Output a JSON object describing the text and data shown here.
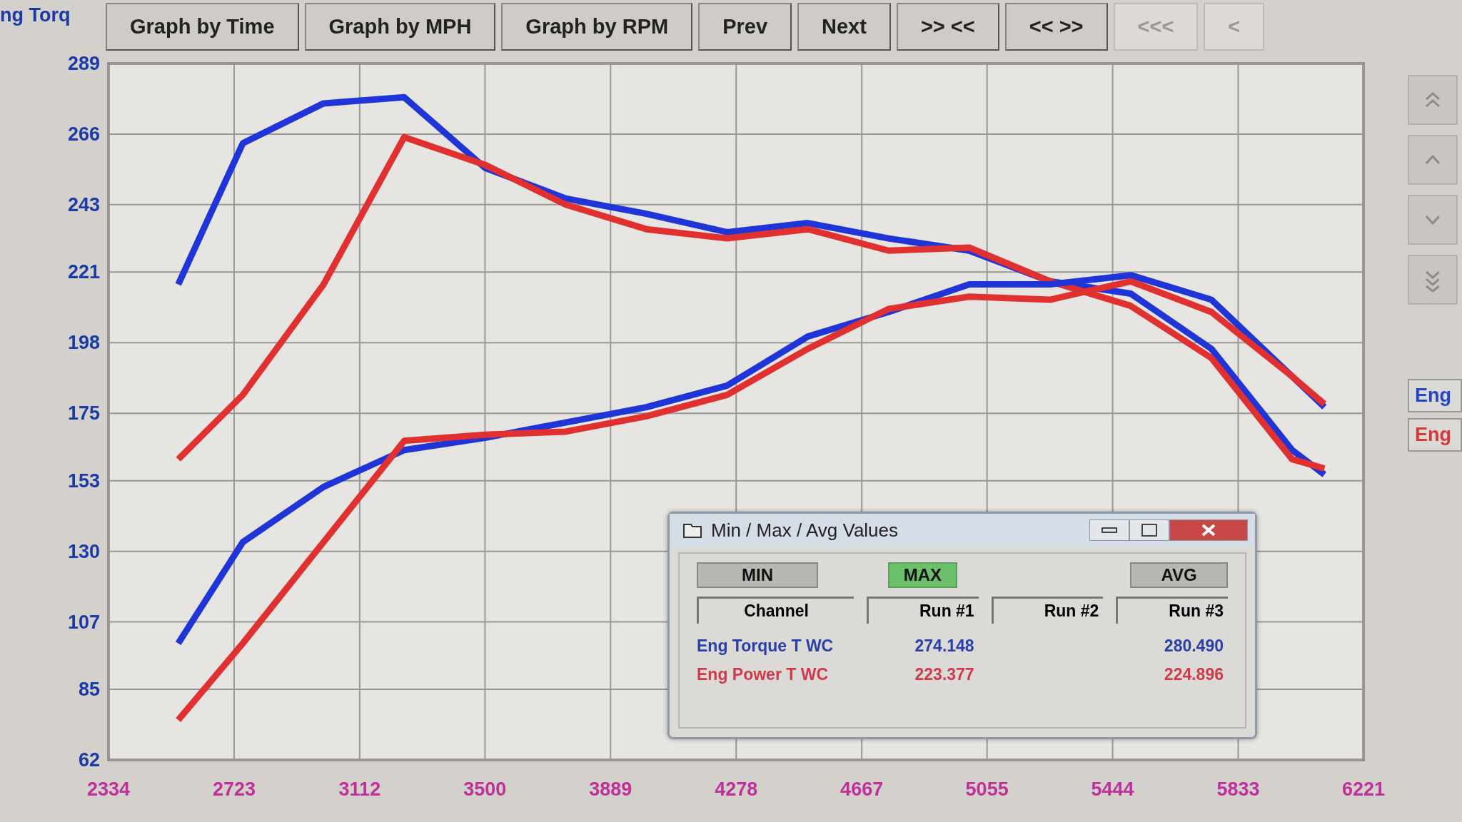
{
  "axis_title": "ng Torq",
  "toolbar": {
    "buttons": [
      {
        "label": "Graph by Time",
        "disabled": false
      },
      {
        "label": "Graph by MPH",
        "disabled": false
      },
      {
        "label": "Graph by RPM",
        "disabled": false
      },
      {
        "label": "Prev",
        "disabled": false
      },
      {
        "label": "Next",
        "disabled": false
      },
      {
        "label": ">> <<",
        "disabled": false
      },
      {
        "label": "<< >>",
        "disabled": false
      },
      {
        "label": "<<<",
        "disabled": true
      },
      {
        "label": "<",
        "disabled": true
      }
    ]
  },
  "side_panel": {
    "icon_buttons": [
      {
        "kind": "up-double"
      },
      {
        "kind": "up"
      },
      {
        "kind": "down"
      },
      {
        "kind": "down-double"
      }
    ],
    "legend": [
      {
        "label": "Eng",
        "color": "#2545c8"
      },
      {
        "label": "Eng",
        "color": "#d83838"
      }
    ]
  },
  "chart": {
    "chart_data": {
      "type": "line",
      "x": [
        2550,
        2750,
        3000,
        3250,
        3500,
        3750,
        4000,
        4250,
        4500,
        4750,
        5000,
        5250,
        5500,
        5750,
        6000,
        6100
      ],
      "series": [
        {
          "color": "#1f35d8",
          "values": [
            217,
            263,
            276,
            278,
            255,
            245,
            240,
            234,
            237,
            232,
            228,
            218,
            214,
            196,
            163,
            155
          ]
        },
        {
          "color": "#e03030",
          "values": [
            160,
            181,
            217,
            265,
            256,
            243,
            235,
            232,
            235,
            228,
            229,
            218,
            210,
            193,
            160,
            157
          ]
        },
        {
          "color": "#1f35d8",
          "values": [
            100,
            133,
            151,
            163,
            167,
            172,
            177,
            184,
            200,
            208,
            217,
            217,
            220,
            212,
            187,
            177
          ]
        },
        {
          "color": "#e03030",
          "values": [
            75,
            100,
            133,
            166,
            168,
            169,
            174,
            181,
            196,
            209,
            213,
            212,
            218,
            208,
            187,
            178
          ]
        }
      ],
      "xlim": [
        2334,
        6221
      ],
      "ylim": [
        62,
        289
      ],
      "xticks": [
        2334,
        2723,
        3112,
        3500,
        3889,
        4278,
        4667,
        5055,
        5444,
        5833,
        6221
      ],
      "yticks": [
        289,
        266,
        243,
        221,
        198,
        175,
        153,
        130,
        107,
        85,
        62
      ],
      "grid": true
    }
  },
  "dialog": {
    "title": "Min / Max / Avg Values",
    "modes": [
      {
        "label": "MIN",
        "selected": false
      },
      {
        "label": "MAX",
        "selected": true
      },
      {
        "label": "AVG",
        "selected": false
      }
    ],
    "columns": [
      "Channel",
      "Run #1",
      "Run #2",
      "Run #3"
    ],
    "rows": [
      {
        "channel": "Eng Torque T WC",
        "color": "#2a3fa8",
        "run_1": "274.148",
        "run_3": "280.490"
      },
      {
        "channel": "Eng Power T WC",
        "color": "#d03a4a",
        "run_1": "223.377",
        "run_3": "224.896"
      }
    ]
  }
}
